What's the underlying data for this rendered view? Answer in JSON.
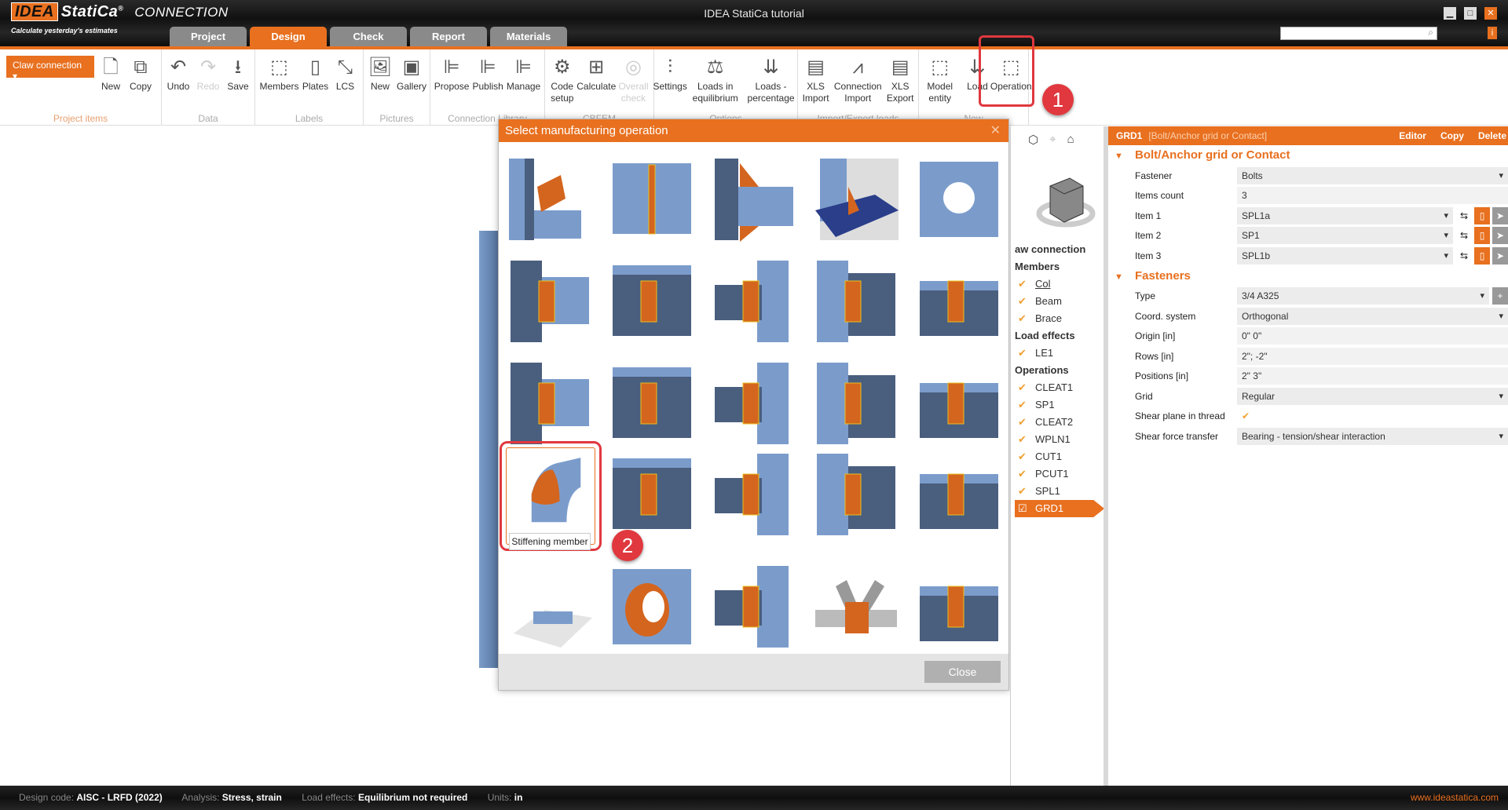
{
  "app": {
    "logo": "IDEA StatiCa",
    "logo_suffix": "®",
    "product": "CONNECTION",
    "tagline": "Calculate yesterday's estimates",
    "window_title": "IDEA StatiCa tutorial"
  },
  "tabs": [
    {
      "label": "Project"
    },
    {
      "label": "Design",
      "active": true
    },
    {
      "label": "Check"
    },
    {
      "label": "Report"
    },
    {
      "label": "Materials"
    }
  ],
  "ribbon": {
    "project_dropdown": "Claw connection",
    "groups": [
      {
        "label": "Project items",
        "buttons": [
          {
            "label": "New",
            "icon": "new-doc-icon"
          },
          {
            "label": "Copy",
            "icon": "copy-icon"
          }
        ]
      },
      {
        "label": "Data",
        "buttons": [
          {
            "label": "Undo",
            "icon": "undo-icon"
          },
          {
            "label": "Redo",
            "icon": "redo-icon",
            "disabled": true
          },
          {
            "label": "Save",
            "icon": "save-icon"
          }
        ]
      },
      {
        "label": "Labels",
        "buttons": [
          {
            "label": "Members",
            "icon": "members-icon"
          },
          {
            "label": "Plates",
            "icon": "plates-icon"
          },
          {
            "label": "LCS",
            "icon": "lcs-icon"
          }
        ]
      },
      {
        "label": "Pictures",
        "buttons": [
          {
            "label": "New",
            "icon": "new-picture-icon"
          },
          {
            "label": "Gallery",
            "icon": "gallery-icon"
          }
        ]
      },
      {
        "label": "Connection Library",
        "buttons": [
          {
            "label": "Propose",
            "icon": "propose-icon"
          },
          {
            "label": "Publish",
            "icon": "publish-icon"
          },
          {
            "label": "Manage",
            "icon": "manage-icon"
          }
        ]
      },
      {
        "label": "CBFEM",
        "buttons": [
          {
            "label": "Code setup",
            "icon": "code-setup-icon"
          },
          {
            "label": "Calculate",
            "icon": "calculate-icon"
          },
          {
            "label": "Overall check",
            "icon": "overall-check-icon",
            "disabled": true
          }
        ]
      },
      {
        "label": "Options",
        "buttons": [
          {
            "label": "Settings",
            "icon": "settings-icon"
          },
          {
            "label": "Loads in equilibrium",
            "icon": "balance-icon"
          },
          {
            "label": "Loads - percentage",
            "icon": "loads-percentage-icon"
          }
        ]
      },
      {
        "label": "Import/Export loads",
        "buttons": [
          {
            "label": "XLS Import",
            "icon": "xls-import-icon"
          },
          {
            "label": "Connection Import",
            "icon": "connection-import-icon"
          },
          {
            "label": "XLS Export",
            "icon": "xls-export-icon"
          }
        ]
      },
      {
        "label": "New",
        "buttons": [
          {
            "label": "Model entity",
            "icon": "model-entity-icon"
          },
          {
            "label": "Load",
            "icon": "load-icon"
          },
          {
            "label": "Operation",
            "icon": "operation-icon"
          }
        ]
      }
    ]
  },
  "annotations": {
    "badge1": "1",
    "badge2": "2"
  },
  "dialog": {
    "title": "Select manufacturing operation",
    "close_label": "Close",
    "hover_tooltip": "Stiffening member",
    "tiles": [
      "cleat-angle",
      "stiffener",
      "haunch",
      "base-plate-stiffener",
      "opening",
      "fin-plate",
      "end-plate-notch",
      "splice-plate",
      "web-splice",
      "flange-splice-bolts",
      "brace-gusset",
      "tube-end-plate",
      "bolted-web-plate",
      "angle-cleat",
      "base-plate-anchors",
      "stiffening-member",
      "web-plate",
      "cut-flange",
      "gusset-bolted",
      "flange-plate",
      "concrete-block",
      "pipe-opening",
      "weld-preparation",
      "truss-node",
      "bolted-end-plate"
    ]
  },
  "nav": {
    "items": [
      {
        "label": "aw connection",
        "type": "head"
      },
      {
        "label": "Members",
        "type": "head"
      },
      {
        "label": "Col",
        "type": "check"
      },
      {
        "label": "Beam",
        "type": "check"
      },
      {
        "label": "Brace",
        "type": "check"
      },
      {
        "label": "Load effects",
        "type": "head"
      },
      {
        "label": "LE1",
        "type": "check"
      },
      {
        "label": "Operations",
        "type": "head"
      },
      {
        "label": "CLEAT1",
        "type": "check"
      },
      {
        "label": "SP1",
        "type": "check"
      },
      {
        "label": "CLEAT2",
        "type": "check"
      },
      {
        "label": "WPLN1",
        "type": "check"
      },
      {
        "label": "CUT1",
        "type": "check"
      },
      {
        "label": "PCUT1",
        "type": "check"
      },
      {
        "label": "SPL1",
        "type": "check"
      },
      {
        "label": "GRD1",
        "type": "check",
        "active": true
      }
    ]
  },
  "props": {
    "header_id": "GRD1",
    "header_type": "[Bolt/Anchor grid or Contact]",
    "editor": "Editor",
    "copy": "Copy",
    "delete": "Delete",
    "sections": [
      {
        "title": "Bolt/Anchor grid or Contact",
        "rows": [
          {
            "label": "Fastener",
            "value": "Bolts",
            "dropdown": true
          },
          {
            "label": "Items count",
            "value": "3"
          },
          {
            "label": "Item 1",
            "value": "SPL1a",
            "dropdown": true,
            "tools": true
          },
          {
            "label": "Item 2",
            "value": "SP1",
            "dropdown": true,
            "tools": true
          },
          {
            "label": "Item 3",
            "value": "SPL1b",
            "dropdown": true,
            "tools": true
          }
        ]
      },
      {
        "title": "Fasteners",
        "rows": [
          {
            "label": "Type",
            "value": "3/4 A325",
            "dropdown": true,
            "plus": true
          },
          {
            "label": "Coord. system",
            "value": "Orthogonal",
            "dropdown": true
          },
          {
            "label": "Origin [in]",
            "value": "0\" 0\""
          },
          {
            "label": "Rows [in]",
            "value": "2\"; -2\""
          },
          {
            "label": "Positions [in]",
            "value": "2\" 3\""
          },
          {
            "label": "Grid",
            "value": "Regular",
            "dropdown": true
          },
          {
            "label": "Shear plane in thread",
            "value": "✔",
            "checkbox": true
          },
          {
            "label": "Shear force transfer",
            "value": "Bearing - tension/shear interaction",
            "dropdown": true
          }
        ]
      }
    ]
  },
  "status": {
    "design_code_label": "Design code:",
    "design_code": "AISC - LRFD (2022)",
    "analysis_label": "Analysis:",
    "analysis": "Stress, strain",
    "load_effects_label": "Load effects:",
    "load_effects": "Equilibrium not required",
    "units_label": "Units:",
    "units": "in",
    "url": "www.ideastatica.com"
  },
  "colors": {
    "accent": "#e8701f",
    "steel": "#7b9ccb",
    "steel_dark": "#4a5e7e",
    "plate": "#d4651e",
    "weld": "#e8c020",
    "highlight": "#e0383e"
  }
}
